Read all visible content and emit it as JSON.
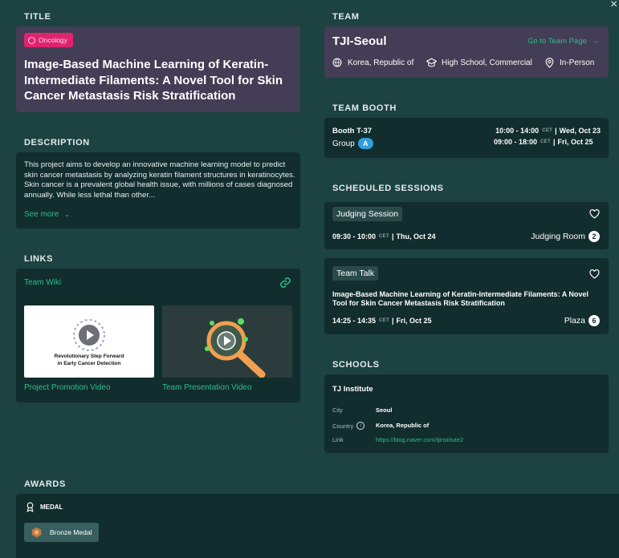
{
  "close_label": "×",
  "title_section": {
    "label": "TITLE",
    "badge": "Oncology",
    "title": "Image-Based Machine Learning of Keratin-Intermediate Filaments: A Novel Tool for Skin Cancer Metastasis Risk Stratification"
  },
  "description": {
    "label": "DESCRIPTION",
    "text": "This project aims to develop an innovative machine learning model to predict skin cancer metastasis by analyzing keratin filament structures in keratinocytes. Skin cancer is a prevalent global health issue, with millions of cases diagnosed annually. While less lethal than other...",
    "see_more": "See more"
  },
  "links": {
    "label": "LINKS",
    "wiki": "Team Wiki",
    "videos": [
      {
        "caption": "Project Promotion Video",
        "thumb_text_1": "Revolutionary Step Forward",
        "thumb_text_2": "in Early Cancer Detection"
      },
      {
        "caption": "Team Presentation Video"
      }
    ]
  },
  "team": {
    "label": "TEAM",
    "name": "TJI-Seoul",
    "goto": "Go to Team Page",
    "country": "Korea, Republic of",
    "school_type": "High School, Commercial",
    "format": "In-Person"
  },
  "booth": {
    "label": "TEAM BOOTH",
    "booth": "Booth T-37",
    "group_label": "Group",
    "group": "A",
    "times": [
      {
        "time": "10:00 - 14:00",
        "tz": "CET",
        "day": "Wed, Oct 23"
      },
      {
        "time": "09:00 - 18:00",
        "tz": "CET",
        "day": "Fri, Oct 25"
      }
    ]
  },
  "sessions": {
    "label": "SCHEDULED SESSIONS",
    "items": [
      {
        "tag": "Judging Session",
        "time": "09:30 - 10:00",
        "tz": "CET",
        "day": "Thu, Oct 24",
        "room": "Judging Room",
        "room_num": "2"
      },
      {
        "tag": "Team Talk",
        "title": "Image-Based Machine Learning of Keratin-Intermediate Filaments: A Novel Tool for Skin Cancer Metastasis Risk Stratification",
        "time": "14:25 - 14:35",
        "tz": "CET",
        "day": "Fri, Oct 25",
        "room": "Plaza",
        "room_num": "6"
      }
    ]
  },
  "schools": {
    "label": "SCHOOLS",
    "name": "TJ Institute",
    "city_label": "City",
    "city": "Seoul",
    "country_label": "Country",
    "country": "Korea, Republic of",
    "link_label": "Link",
    "link": "https://blog.naver.com/tjinstitute2"
  },
  "awards": {
    "label": "AWARDS",
    "medal_label": "MEDAL",
    "medal": "Bronze Medal"
  },
  "colors": {
    "background": "#1c4242",
    "card": "#122d2d",
    "title_card": "#433d55",
    "accent_green": "#2ebd8c",
    "badge_pink": "#e0236f",
    "group_blue": "#2d9fe0"
  }
}
